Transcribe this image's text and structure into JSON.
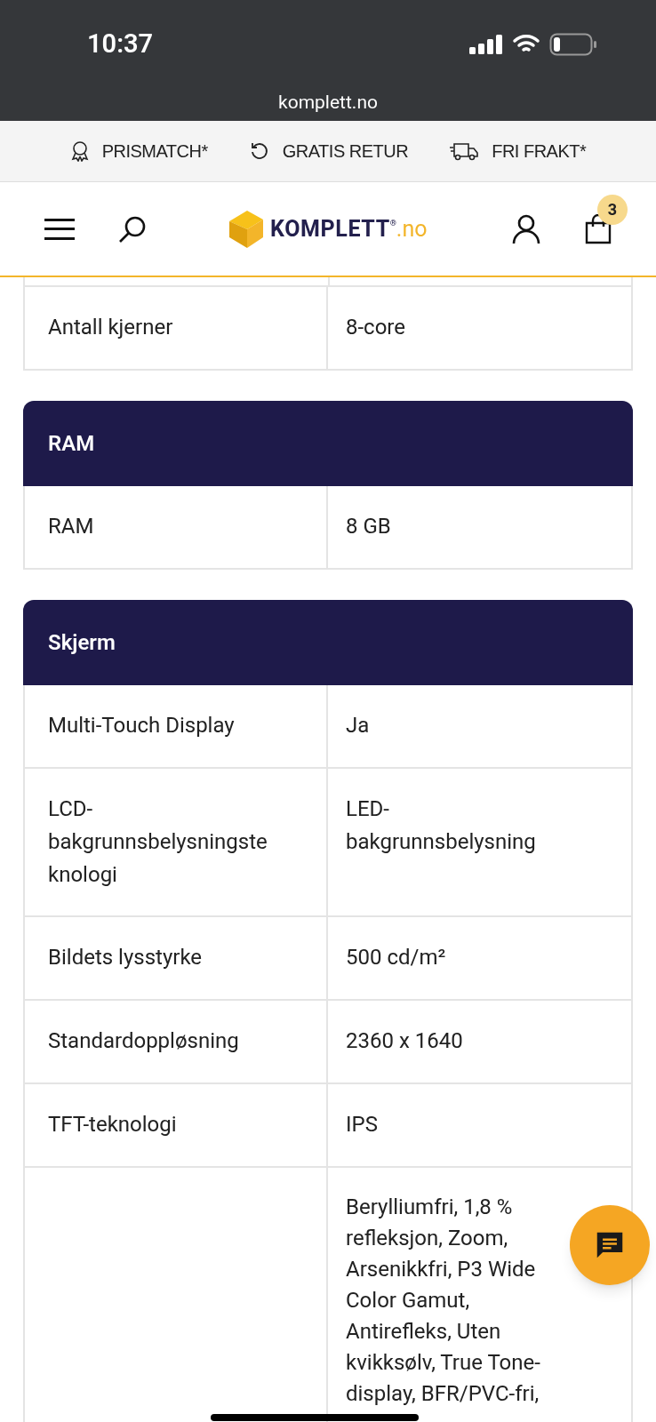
{
  "status_bar": {
    "time": "10:37"
  },
  "browser": {
    "url": "komplett.no"
  },
  "promo_bar": [
    {
      "kind": "award",
      "label": "PRISMATCH*"
    },
    {
      "kind": "return",
      "label": "GRATIS RETUR"
    },
    {
      "kind": "truck",
      "label": "FRI FRAKT*"
    }
  ],
  "header": {
    "logo": {
      "brand": "KOMPLETT",
      "mark": "®",
      "suffix": ".no"
    },
    "cart_count": "3"
  },
  "sections": [
    {
      "rows": [
        {
          "label": "Antall kjerner",
          "value": "8-core"
        }
      ]
    },
    {
      "title": "RAM",
      "rows": [
        {
          "label": "RAM",
          "value": "8 GB"
        }
      ]
    },
    {
      "title": "Skjerm",
      "rows": [
        {
          "label": "Multi-Touch Display",
          "value": "Ja"
        },
        {
          "label": "LCD-bakgrunnsbelysningsteknologi",
          "value": "LED-bakgrunnsbelysning"
        },
        {
          "label": "Bildets lysstyrke",
          "value": "500 cd/m²"
        },
        {
          "label": "Standardoppløsning",
          "value": "2360 x 1640"
        },
        {
          "label": "TFT-teknologi",
          "value": "IPS"
        },
        {
          "value": "Berylliumfri, 1,8 % refleksjon, Zoom, Arsenikkfri, P3 Wide Color Gamut, Antirefleks, Uten kvikksølv, True Tone-display, BFR/PVC-fri,"
        }
      ]
    }
  ]
}
